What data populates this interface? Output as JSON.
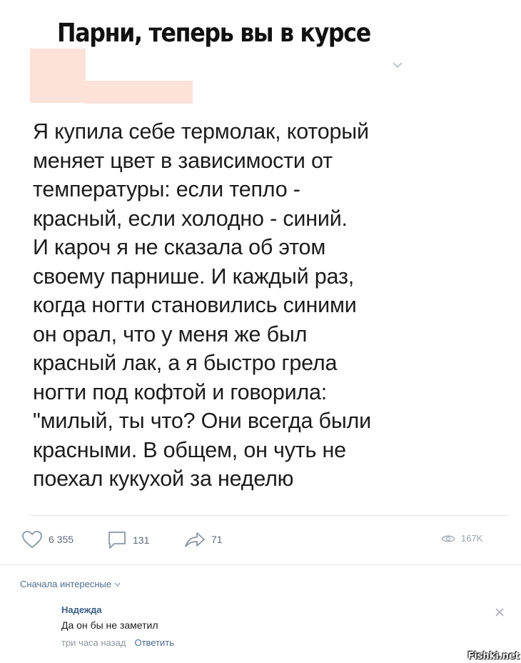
{
  "header": {
    "title": "Парни, теперь вы в курсе",
    "expand_icon": "chevron-down-icon"
  },
  "post": {
    "text": "Я купила себе термолак, который\nменяет цвет в зависимости от\nтемпературы: если тепло -\nкрасный, если холодно - синий.\nИ кароч я не сказала об этом\nсвоему парнише. И каждый раз,\nкогда ногти становились синими\nон орал, что у меня же был\nкрасный лак, а я быстро грела\nногти под кофтой и говорила:\n\"милый, ты что? Они всегда были\nкрасными. В общем, он чуть не\nпоехал кукухой за неделю"
  },
  "actions": {
    "likes": "6 355",
    "comments": "131",
    "shares": "71",
    "views": "167K",
    "icons": [
      "heart-icon",
      "comment-icon",
      "share-icon",
      "eye-icon"
    ]
  },
  "comments": {
    "sort_label": "Сначала интересные",
    "items": [
      {
        "author": "Надежда",
        "text": "Да он бы не заметил",
        "time": "три часа назад",
        "reply_label": "Ответить"
      }
    ]
  },
  "watermark": "Fishki.net",
  "colors": {
    "highlight": "#fde2da",
    "link": "#3a5f89",
    "muted": "#8f98a3",
    "icon": "#5d6a7a"
  }
}
